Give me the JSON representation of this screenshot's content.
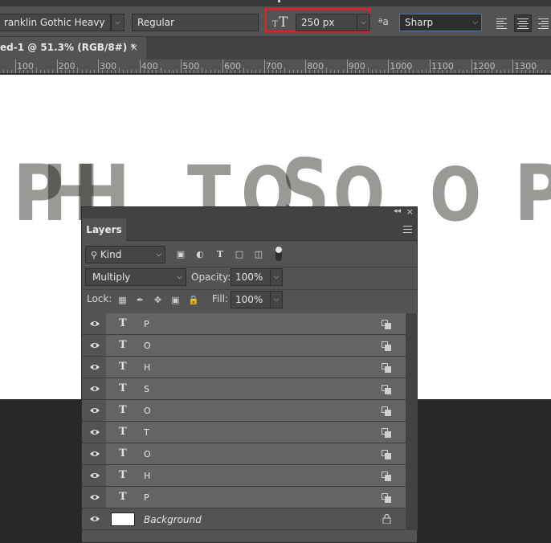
{
  "options_bar": {
    "font_family": "ranklin Gothic Heavy",
    "font_style": "Regular",
    "font_size": "250 px",
    "antialias": "Sharp"
  },
  "document_tab": {
    "title": "ed-1 @ 51.3% (RGB/8#) *",
    "close_glyph": "×"
  },
  "ruler": {
    "ticks": [
      "100",
      "200",
      "300",
      "400",
      "500",
      "600",
      "700",
      "800",
      "900",
      "1000",
      "1100",
      "1200",
      "1300"
    ]
  },
  "canvas_glyphs": [
    "P",
    "H",
    "H",
    "T",
    "O",
    "S",
    "O",
    "O",
    "P"
  ],
  "layers_panel": {
    "tab": "Layers",
    "filter_kind": "Kind",
    "blend_mode": "Multiply",
    "opacity_label": "Opacity:",
    "opacity": "100%",
    "lock_label": "Lock:",
    "fill_label": "Fill:",
    "fill": "100%",
    "layers": [
      {
        "type": "text",
        "name": "P"
      },
      {
        "type": "text",
        "name": "O"
      },
      {
        "type": "text",
        "name": "H"
      },
      {
        "type": "text",
        "name": "S"
      },
      {
        "type": "text",
        "name": "O"
      },
      {
        "type": "text",
        "name": "T"
      },
      {
        "type": "text",
        "name": "O"
      },
      {
        "type": "text",
        "name": "H"
      },
      {
        "type": "text",
        "name": "P"
      },
      {
        "type": "background",
        "name": "Background"
      }
    ]
  },
  "colors": {
    "highlight_border": "#d8232a",
    "glyph_gray": "#9a9995",
    "panel_bg": "#535353",
    "canvas": "#ffffff"
  }
}
